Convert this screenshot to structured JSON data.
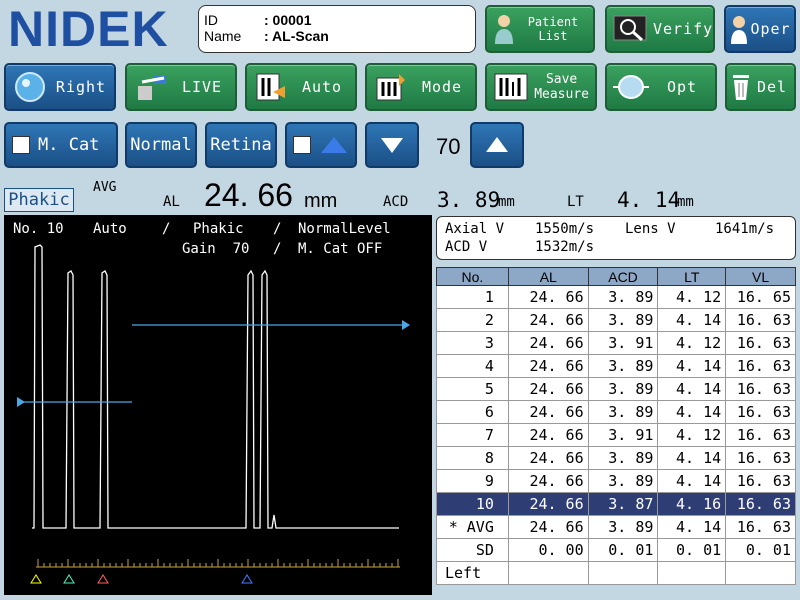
{
  "brand": {
    "logo": "NIDEK"
  },
  "patient": {
    "id_label": "ID",
    "id_value": ": 00001",
    "name_label": "Name",
    "name_value": ": AL-Scan"
  },
  "top_buttons": {
    "patient_list": "Patient List",
    "verify": "Verify",
    "operator": "Oper"
  },
  "toolbar": {
    "right": "Right",
    "live": "LIVE",
    "auto": "Auto",
    "mode": "Mode",
    "save_measure_1": "Save",
    "save_measure_2": "Measure",
    "opt": "Opt",
    "del": "Del"
  },
  "controls": {
    "mcat": "M. Cat",
    "normal": "Normal",
    "retina": "Retina",
    "gain_value": "70"
  },
  "measurement": {
    "mode": "Phakic",
    "avg_label": "AVG",
    "al_label": "AL",
    "al_value": "24. 66",
    "al_unit": "mm",
    "acd_label": "ACD",
    "acd_value": "3. 89",
    "acd_unit": "mm",
    "lt_label": "LT",
    "lt_value": "4. 14",
    "lt_unit": "mm"
  },
  "wave": {
    "no": "No. 10",
    "mode": "Auto",
    "sep": "/",
    "eye": "Phakic",
    "level": "NormalLevel",
    "gain": "Gain  70",
    "mcat": "M. Cat OFF"
  },
  "velocity": {
    "axial_label": "Axial V",
    "axial_value": "1550m/s",
    "lens_label": "Lens V",
    "lens_value": "1641m/s",
    "acd_label": "ACD V",
    "acd_value": "1532m/s"
  },
  "table": {
    "headers": [
      "No.",
      "AL",
      "ACD",
      "LT",
      "VL"
    ],
    "rows": [
      [
        "1",
        "24. 66",
        "3. 89",
        "4. 12",
        "16. 65"
      ],
      [
        "2",
        "24. 66",
        "3. 89",
        "4. 14",
        "16. 63"
      ],
      [
        "3",
        "24. 66",
        "3. 91",
        "4. 12",
        "16. 63"
      ],
      [
        "4",
        "24. 66",
        "3. 89",
        "4. 14",
        "16. 63"
      ],
      [
        "5",
        "24. 66",
        "3. 89",
        "4. 14",
        "16. 63"
      ],
      [
        "6",
        "24. 66",
        "3. 89",
        "4. 14",
        "16. 63"
      ],
      [
        "7",
        "24. 66",
        "3. 91",
        "4. 12",
        "16. 63"
      ],
      [
        "8",
        "24. 66",
        "3. 89",
        "4. 14",
        "16. 63"
      ],
      [
        "9",
        "24. 66",
        "3. 89",
        "4. 14",
        "16. 63"
      ],
      [
        "10",
        "24. 66",
        "3. 87",
        "4. 16",
        "16. 63"
      ]
    ],
    "avg": [
      "* AVG",
      "24. 66",
      "3. 89",
      "4. 14",
      "16. 63"
    ],
    "sd": [
      "SD",
      "0. 00",
      "0. 01",
      "0. 01",
      "0. 01"
    ],
    "left": "Left"
  },
  "colors": {
    "accent_green": "#2a8c50",
    "accent_blue": "#1f4fa0",
    "selected_row": "#2e3d74",
    "bg": "#c3d7e3"
  }
}
